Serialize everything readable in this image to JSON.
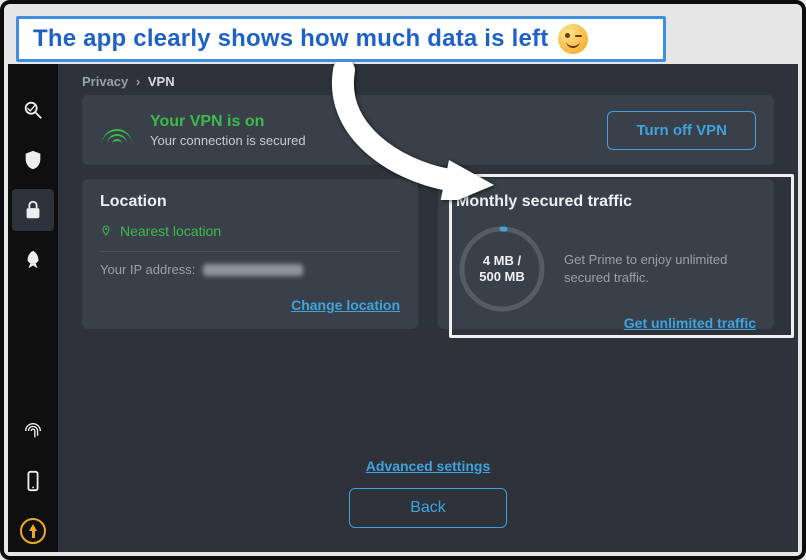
{
  "annotation": {
    "text": "The app clearly shows how much data is left"
  },
  "rail": {
    "items": [
      {
        "name": "scan-icon"
      },
      {
        "name": "shield-icon"
      },
      {
        "name": "lock-icon"
      },
      {
        "name": "rocket-icon"
      }
    ],
    "bottom_items": [
      {
        "name": "fingerprint-icon"
      },
      {
        "name": "phone-icon"
      },
      {
        "name": "update-icon"
      }
    ]
  },
  "breadcrumb": {
    "root": "Privacy",
    "current": "VPN"
  },
  "status": {
    "title": "Your VPN is on",
    "subtitle": "Your connection is secured",
    "button": "Turn off VPN"
  },
  "location": {
    "title": "Location",
    "value": "Nearest location",
    "ip_label": "Your IP address:",
    "change_link": "Change location"
  },
  "traffic": {
    "title": "Monthly secured traffic",
    "used_label": "4 MB /",
    "cap_label": "500 MB",
    "used_mb": 4,
    "cap_mb": 500,
    "message": "Get Prime to enjoy unlimited secured traffic.",
    "link": "Get unlimited traffic"
  },
  "footer": {
    "advanced_link": "Advanced settings",
    "back_button": "Back"
  },
  "colors": {
    "accent_blue": "#3fa3de",
    "accent_green": "#3dbb4a",
    "panel": "#394049",
    "bg": "#2d323b"
  }
}
